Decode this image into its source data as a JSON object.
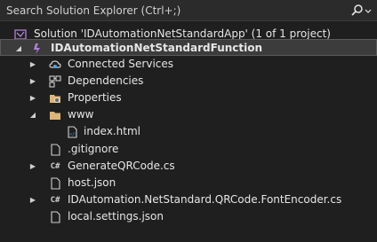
{
  "search": {
    "placeholder": "Search Solution Explorer (Ctrl+;)"
  },
  "solution": {
    "label": "Solution 'IDAutomationNetStandardApp' (1 of 1 project)"
  },
  "project": {
    "label": "IDAutomationNetStandardFunction"
  },
  "items": {
    "connected_services": "Connected Services",
    "dependencies": "Dependencies",
    "properties": "Properties",
    "www": "www",
    "index_html": "index.html",
    "gitignore": ".gitignore",
    "generate_qr": "GenerateQRCode.cs",
    "host_json": "host.json",
    "font_encoder": "IDAutomation.NetStandard.QRCode.FontEncoder.cs",
    "local_settings": "local.settings.json"
  },
  "icons": {
    "cs_glyph": "C#"
  },
  "colors": {
    "background": "#1f1f1f",
    "selected": "#3c3c3c",
    "accent_purple": "#b180d7",
    "folder": "#dcb67a"
  }
}
